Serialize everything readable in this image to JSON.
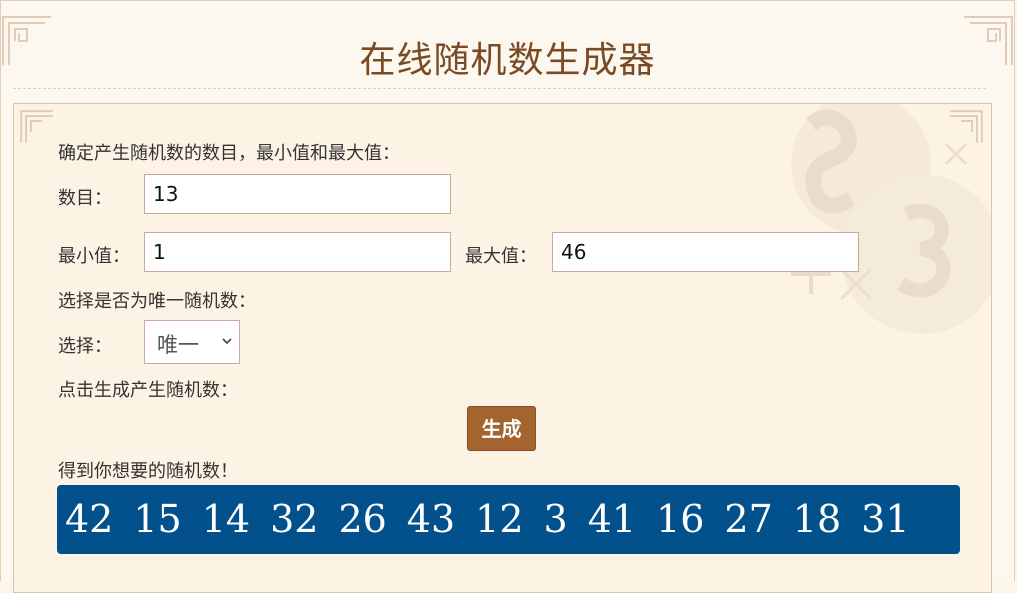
{
  "page": {
    "title": "在线随机数生成器"
  },
  "form": {
    "intro": "确定产生随机数的数目，最小值和最大值：",
    "count_label": "数目：",
    "count_value": "13",
    "min_label": "最小值：",
    "min_value": "1",
    "max_label": "最大值：",
    "max_value": "46",
    "unique_prompt": "选择是否为唯一随机数：",
    "select_label": "选择：",
    "select_value": "唯一",
    "generate_prompt": "点击生成产生随机数：",
    "generate_button": "生成",
    "result_label": "得到你想要的随机数！"
  },
  "results": [
    "42",
    "15",
    "14",
    "32",
    "26",
    "43",
    "12",
    "3",
    "41",
    "16",
    "27",
    "18",
    "31"
  ],
  "colors": {
    "accent": "#a46430",
    "result_bg": "#02508c",
    "title": "#7a4a25"
  }
}
